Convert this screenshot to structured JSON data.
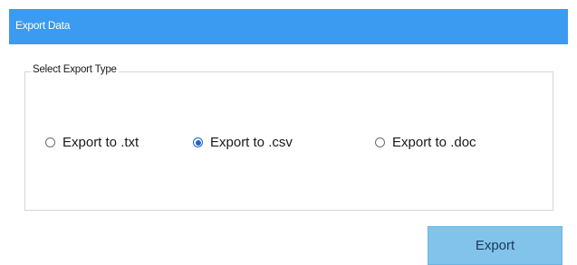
{
  "window": {
    "title": "Export Data"
  },
  "export_type_group": {
    "legend": "Select Export Type",
    "options": [
      {
        "label": "Export to .txt",
        "checked": false
      },
      {
        "label": "Export to .csv",
        "checked": true
      },
      {
        "label": "Export to .doc",
        "checked": false
      }
    ]
  },
  "actions": {
    "export_label": "Export"
  },
  "colors": {
    "titlebar": "#3b9bf0",
    "export_button": "#81c3ea",
    "radio_selected": "#1f64c6"
  }
}
